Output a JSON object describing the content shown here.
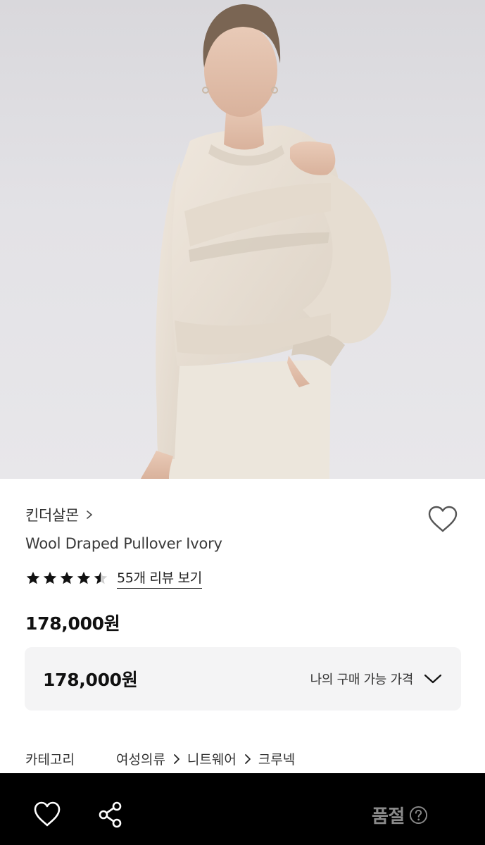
{
  "product": {
    "image_icon": "product-photo",
    "brand": "킨더살몬",
    "name": "Wool Draped Pullover Ivory",
    "rating": 4.5,
    "rating_max": 5,
    "review_link": "55개 리뷰 보기",
    "price": "178,000원"
  },
  "my_price": {
    "amount": "178,000원",
    "label": "나의 구매 가능 가격"
  },
  "category": {
    "label": "카테고리",
    "path": [
      "여성의류",
      "니트웨어",
      "크루넥"
    ]
  },
  "bottom_bar": {
    "status": "품절"
  },
  "colors": {
    "bottom_bar_bg": "#000000",
    "status_text": "#8a8a8a",
    "price_box_bg": "#f4f4f5"
  }
}
